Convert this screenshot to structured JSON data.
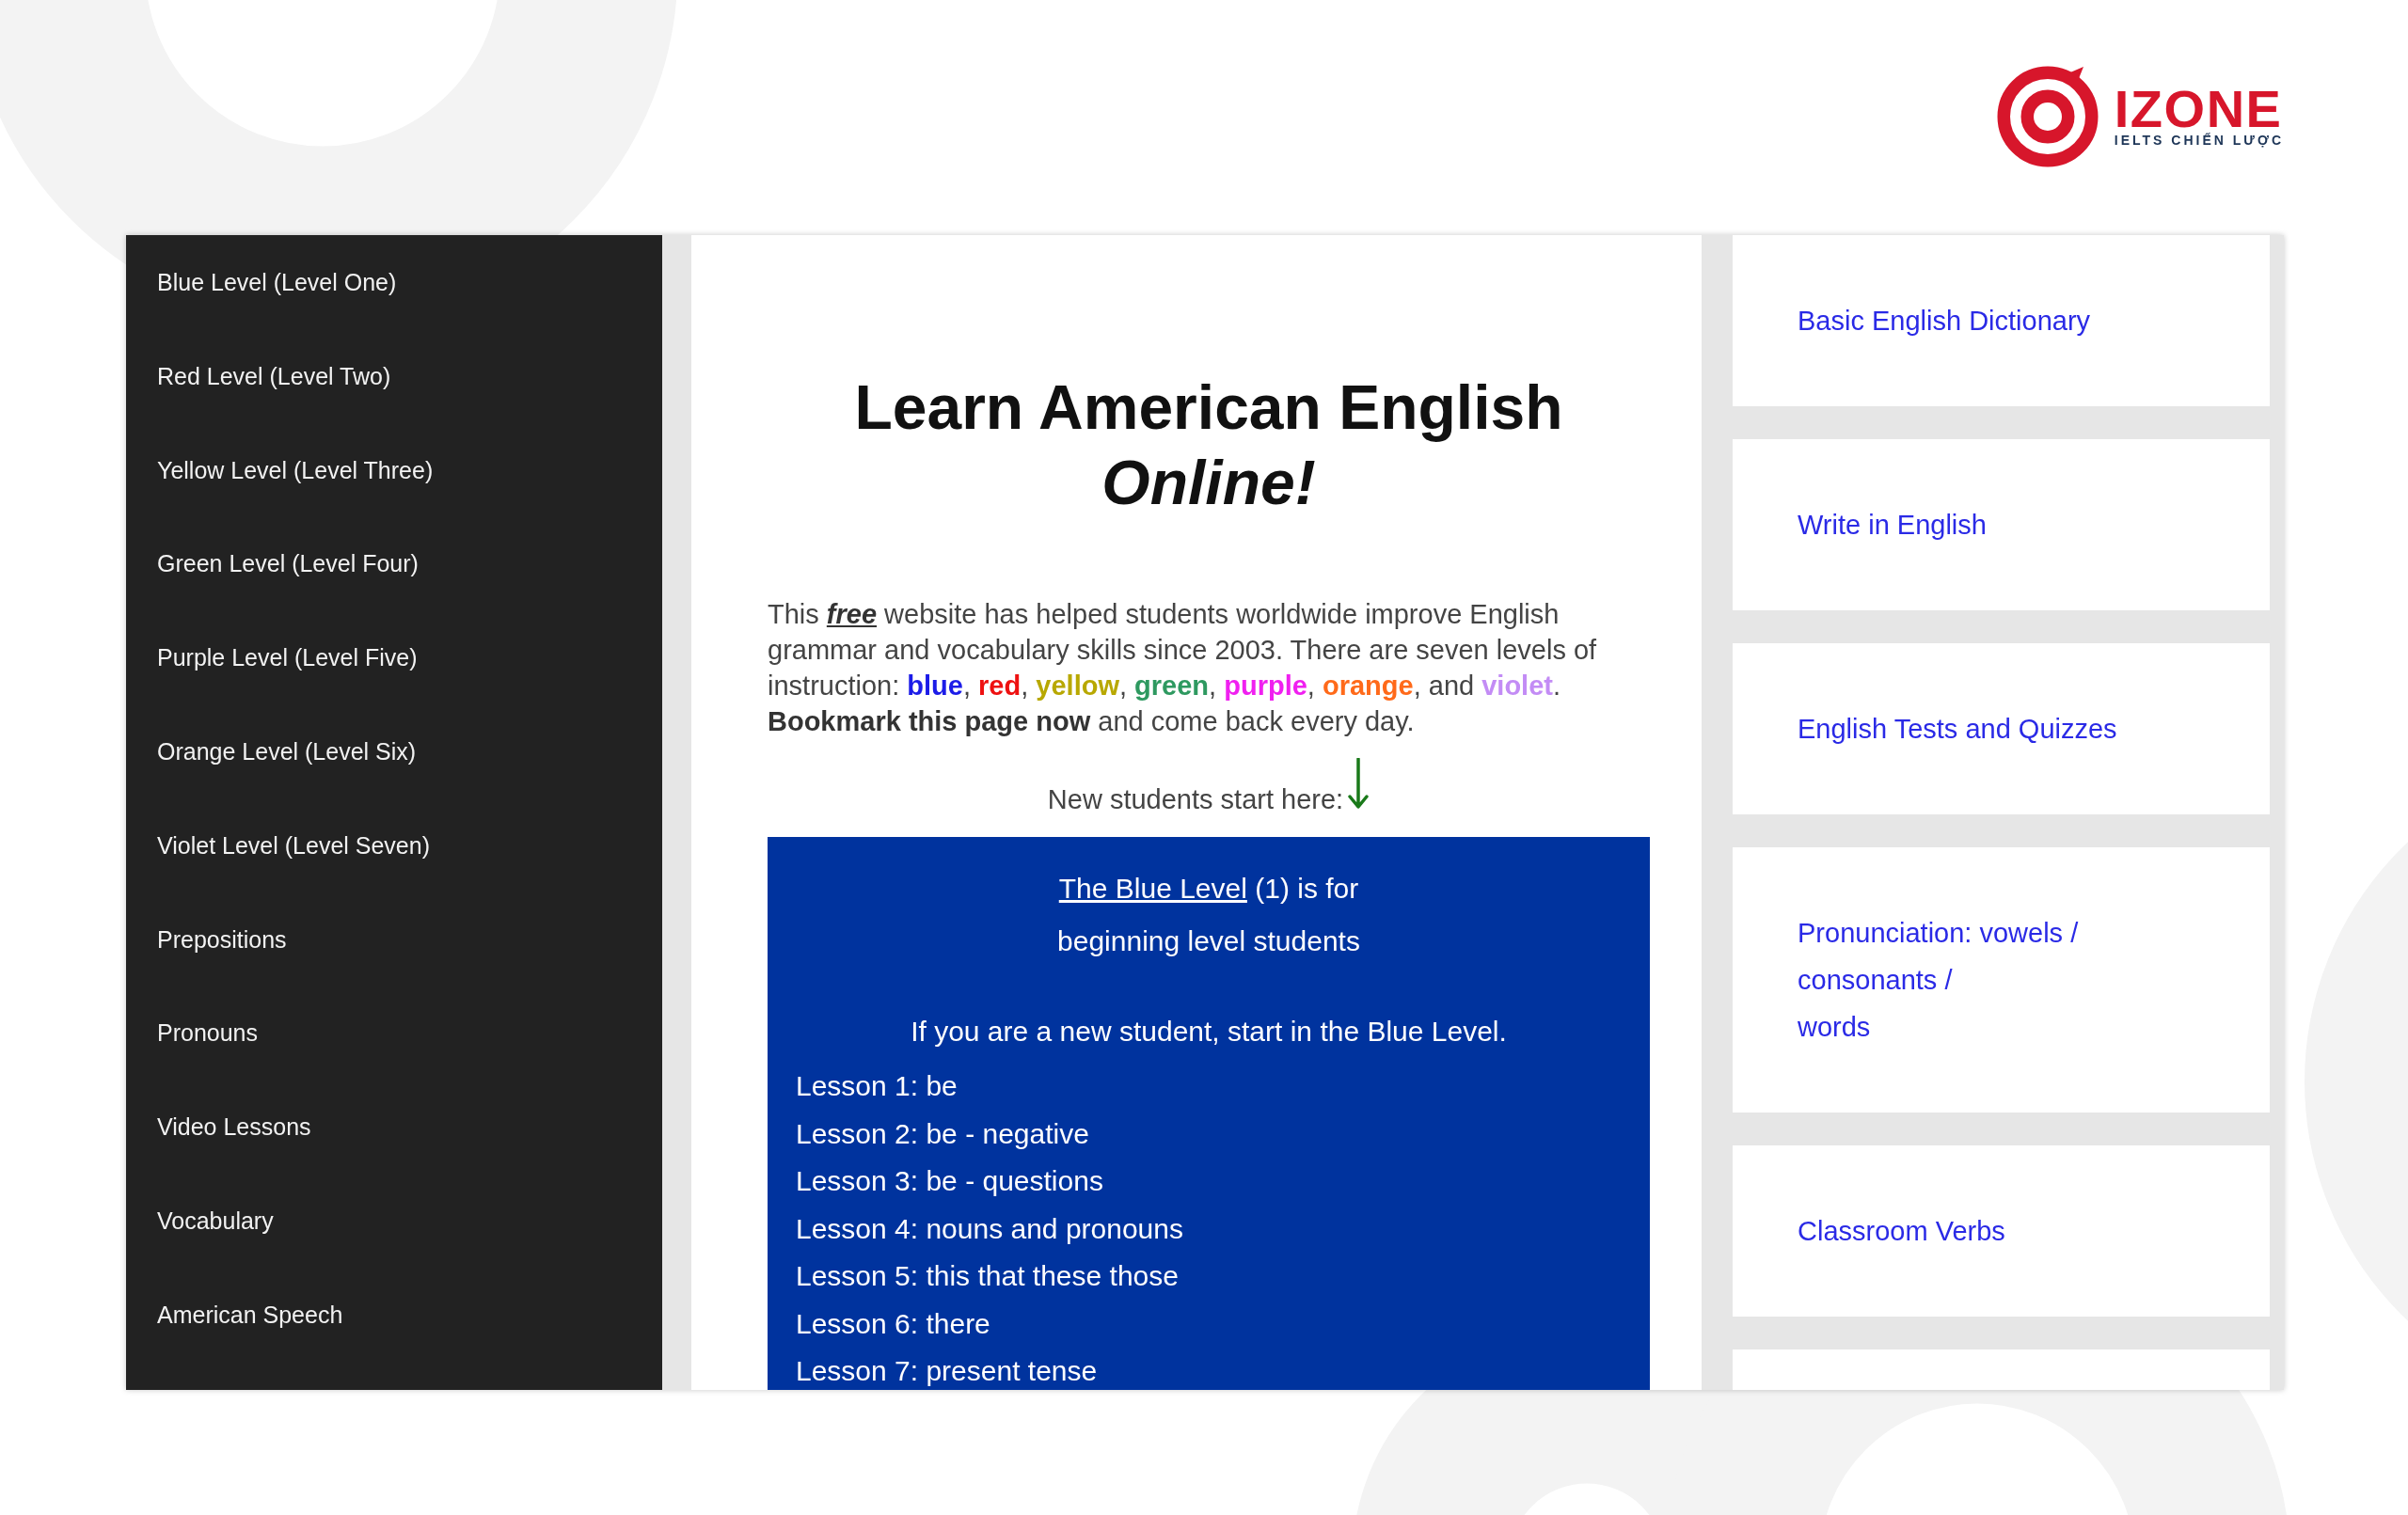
{
  "logo": {
    "wordmark": "IZONE",
    "tagline": "IELTS CHIẾN LƯỢC"
  },
  "sidebar": {
    "items": [
      {
        "label": "Blue Level (Level One)"
      },
      {
        "label": "Red Level (Level Two)"
      },
      {
        "label": "Yellow Level (Level Three)"
      },
      {
        "label": "Green Level (Level Four)"
      },
      {
        "label": "Purple Level (Level Five)"
      },
      {
        "label": "Orange Level (Level Six)"
      },
      {
        "label": "Violet Level (Level Seven)"
      },
      {
        "label": "Prepositions"
      },
      {
        "label": "Pronouns"
      },
      {
        "label": "Video Lessons"
      },
      {
        "label": "Vocabulary"
      },
      {
        "label": "American Speech"
      }
    ]
  },
  "main": {
    "title": "Learn American English *Online!*",
    "intro": [
      {
        "kind": "plain",
        "text": "This "
      },
      {
        "kind": "emphasis",
        "text": "free"
      },
      {
        "kind": "plain",
        "text": " website has helped students worldwide improve English grammar and vocabulary skills since 2003. There are seven levels of instruction: "
      },
      {
        "kind": "level",
        "text": "blue",
        "color": "#1c1ce8"
      },
      {
        "kind": "plain",
        "text": ", "
      },
      {
        "kind": "level",
        "text": "red",
        "color": "#ee1111"
      },
      {
        "kind": "plain",
        "text": ", "
      },
      {
        "kind": "level",
        "text": "yellow",
        "color": "#b8a800"
      },
      {
        "kind": "plain",
        "text": ", "
      },
      {
        "kind": "level",
        "text": "green",
        "color": "#2e9960"
      },
      {
        "kind": "plain",
        "text": ", "
      },
      {
        "kind": "level",
        "text": "purple",
        "color": "#f020f0"
      },
      {
        "kind": "plain",
        "text": ", "
      },
      {
        "kind": "level",
        "text": "orange",
        "color": "#ff6a1a"
      },
      {
        "kind": "plain",
        "text": ", and "
      },
      {
        "kind": "level",
        "text": "violet",
        "color": "#c38cf5"
      },
      {
        "kind": "plain",
        "text": ". "
      },
      {
        "kind": "strong",
        "text": "Bookmark this page now"
      },
      {
        "kind": "plain",
        "text": " and come back every day."
      }
    ],
    "start_prompt": "New students start here:",
    "level_panel": {
      "link": "The Blue Level",
      "link_suffix": " (1) is for",
      "subtitle": "beginning level students",
      "note": "If you are a new student, start in the Blue Level.",
      "lessons": [
        "Lesson 1: be",
        "Lesson 2: be - negative",
        "Lesson 3: be - questions",
        "Lesson 4: nouns and pronouns",
        "Lesson 5: this that these those",
        "Lesson 6: there",
        "Lesson 7: present tense"
      ]
    }
  },
  "resources": {
    "cards": [
      {
        "lines": [
          "Basic English Dictionary"
        ]
      },
      {
        "lines": [
          "Write in English"
        ]
      },
      {
        "lines": [
          "English Tests and Quizzes"
        ]
      },
      {
        "lines": [
          "Pronunciation: vowels /",
          "consonants /",
          "words"
        ]
      },
      {
        "lines": [
          "Classroom Verbs"
        ]
      }
    ]
  }
}
